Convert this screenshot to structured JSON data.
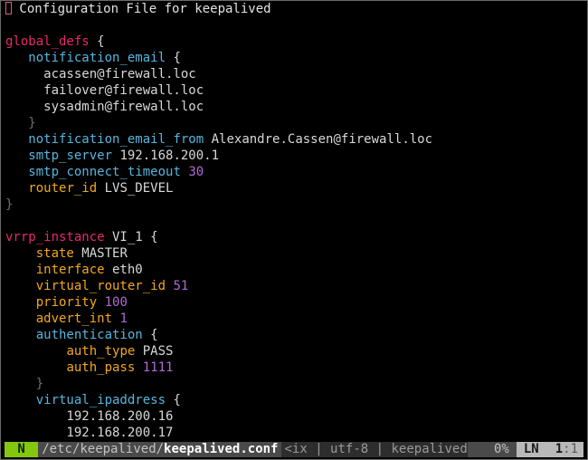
{
  "colors": {
    "background": "#000000",
    "text": "#d8d8d8",
    "comment": "#e2e2e2",
    "section": "#e8286f",
    "keyword": "#f2a81d",
    "option": "#57b5df",
    "number": "#b069d8",
    "brace": "#6f6f6f",
    "cursor": "#e05a85",
    "mode_bg": "#84c70f"
  },
  "editor": {
    "lines": [
      [
        {
          "t": "cursor",
          "text": ""
        },
        {
          "t": "comment",
          "text": " Configuration File for keepalived"
        }
      ],
      [],
      [
        {
          "t": "section",
          "text": "global_defs"
        },
        {
          "t": "text",
          "text": " {"
        }
      ],
      [
        {
          "t": "text",
          "text": "   "
        },
        {
          "t": "option",
          "text": "notification_email"
        },
        {
          "t": "text",
          "text": " {"
        }
      ],
      [
        {
          "t": "text",
          "text": "     acassen@firewall.loc"
        }
      ],
      [
        {
          "t": "text",
          "text": "     failover@firewall.loc"
        }
      ],
      [
        {
          "t": "text",
          "text": "     sysadmin@firewall.loc"
        }
      ],
      [
        {
          "t": "brace",
          "text": "   }"
        }
      ],
      [
        {
          "t": "text",
          "text": "   "
        },
        {
          "t": "option",
          "text": "notification_email_from"
        },
        {
          "t": "text",
          "text": " Alexandre.Cassen@firewall.loc"
        }
      ],
      [
        {
          "t": "text",
          "text": "   "
        },
        {
          "t": "option",
          "text": "smtp_server"
        },
        {
          "t": "text",
          "text": " 192.168.200.1"
        }
      ],
      [
        {
          "t": "text",
          "text": "   "
        },
        {
          "t": "option",
          "text": "smtp_connect_timeout"
        },
        {
          "t": "text",
          "text": " "
        },
        {
          "t": "number",
          "text": "30"
        }
      ],
      [
        {
          "t": "text",
          "text": "   "
        },
        {
          "t": "keyword",
          "text": "router_id"
        },
        {
          "t": "text",
          "text": " LVS_DEVEL"
        }
      ],
      [
        {
          "t": "brace",
          "text": "}"
        }
      ],
      [],
      [
        {
          "t": "section",
          "text": "vrrp_instance"
        },
        {
          "t": "text",
          "text": " VI_1 {"
        }
      ],
      [
        {
          "t": "text",
          "text": "    "
        },
        {
          "t": "keyword",
          "text": "state"
        },
        {
          "t": "text",
          "text": " MASTER"
        }
      ],
      [
        {
          "t": "text",
          "text": "    "
        },
        {
          "t": "keyword",
          "text": "interface"
        },
        {
          "t": "text",
          "text": " eth0"
        }
      ],
      [
        {
          "t": "text",
          "text": "    "
        },
        {
          "t": "keyword",
          "text": "virtual_router_id"
        },
        {
          "t": "text",
          "text": " "
        },
        {
          "t": "number",
          "text": "51"
        }
      ],
      [
        {
          "t": "text",
          "text": "    "
        },
        {
          "t": "keyword",
          "text": "priority"
        },
        {
          "t": "text",
          "text": " "
        },
        {
          "t": "number",
          "text": "100"
        }
      ],
      [
        {
          "t": "text",
          "text": "    "
        },
        {
          "t": "keyword",
          "text": "advert_int"
        },
        {
          "t": "text",
          "text": " "
        },
        {
          "t": "number",
          "text": "1"
        }
      ],
      [
        {
          "t": "text",
          "text": "    "
        },
        {
          "t": "option",
          "text": "authentication"
        },
        {
          "t": "text",
          "text": " {"
        }
      ],
      [
        {
          "t": "text",
          "text": "        "
        },
        {
          "t": "keyword",
          "text": "auth_type"
        },
        {
          "t": "text",
          "text": " PASS"
        }
      ],
      [
        {
          "t": "text",
          "text": "        "
        },
        {
          "t": "keyword",
          "text": "auth_pass"
        },
        {
          "t": "text",
          "text": " "
        },
        {
          "t": "number",
          "text": "1111"
        }
      ],
      [
        {
          "t": "brace",
          "text": "    }"
        }
      ],
      [
        {
          "t": "text",
          "text": "    "
        },
        {
          "t": "option",
          "text": "virtual_ipaddress"
        },
        {
          "t": "text",
          "text": " {"
        }
      ],
      [
        {
          "t": "text",
          "text": "        192.168.200.16"
        }
      ],
      [
        {
          "t": "text",
          "text": "        192.168.200.17"
        }
      ]
    ]
  },
  "statusline": {
    "mode": "N",
    "path_prefix": "/etc/keepalived/",
    "filename": "keepalived.conf",
    "info": "<ix | utf-8 | keepalived",
    "percent": "0%",
    "ln_label": "LN",
    "line": "1",
    "col_sep": ":",
    "col": "1"
  }
}
